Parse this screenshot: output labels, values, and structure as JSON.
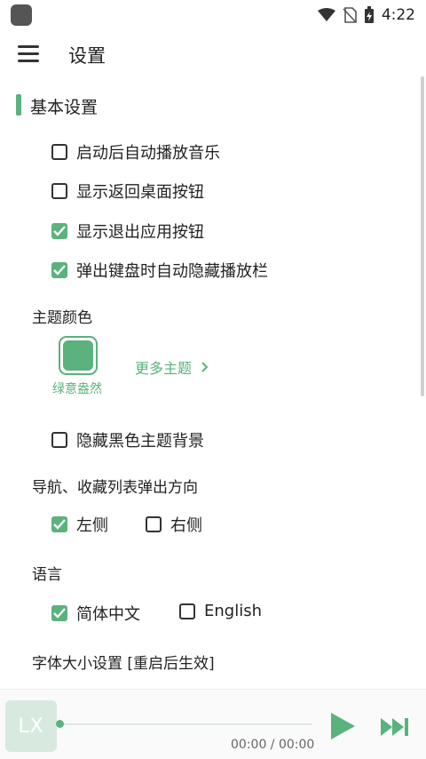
{
  "status_bar": {
    "time": "4:22"
  },
  "app_bar": {
    "title": "设置"
  },
  "section": {
    "title": "基本设置"
  },
  "basic_options": [
    {
      "label": "启动后自动播放音乐",
      "checked": false
    },
    {
      "label": "显示返回桌面按钮",
      "checked": false
    },
    {
      "label": "显示退出应用按钮",
      "checked": true
    },
    {
      "label": "弹出键盘时自动隐藏播放栏",
      "checked": true
    }
  ],
  "theme": {
    "label": "主题颜色",
    "selected_name": "绿意盎然",
    "color": "#5ab27c",
    "more_label": "更多主题"
  },
  "hide_black_bg": {
    "label": "隐藏黑色主题背景",
    "checked": false
  },
  "nav_direction": {
    "label": "导航、收藏列表弹出方向",
    "options": [
      {
        "label": "左侧",
        "checked": true
      },
      {
        "label": "右侧",
        "checked": false
      }
    ]
  },
  "language": {
    "label": "语言",
    "options": [
      {
        "label": "简体中文",
        "checked": true
      },
      {
        "label": "English",
        "checked": false
      }
    ]
  },
  "font_size": {
    "label": "字体大小设置 [重启后生效]"
  },
  "player": {
    "logo_text": "LX",
    "time": "00:00 / 00:00"
  },
  "colors": {
    "accent": "#5ab27c"
  }
}
